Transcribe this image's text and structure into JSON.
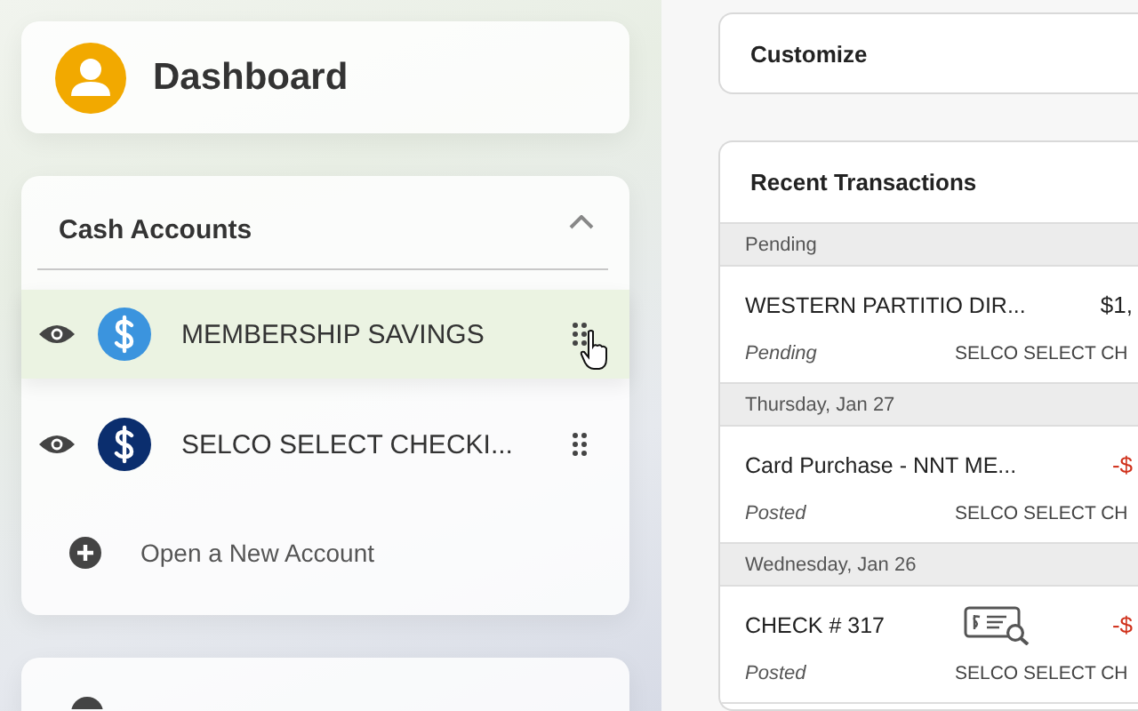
{
  "dashboard": {
    "title": "Dashboard"
  },
  "cash_accounts": {
    "title": "Cash Accounts",
    "expanded": true,
    "accounts": [
      {
        "name": "MEMBERSHIP SAVINGS",
        "color": "#3b94de",
        "highlighted": true
      },
      {
        "name": "SELCO SELECT CHECKI...",
        "color": "#0b2e6e",
        "highlighted": false
      }
    ],
    "open_account": "Open a New Account"
  },
  "customize": {
    "label": "Customize"
  },
  "recent_transactions": {
    "title": "Recent Transactions",
    "items": [
      {
        "kind": "group",
        "label": "Pending"
      },
      {
        "kind": "transaction",
        "description": "WESTERN PARTITIO DIR...",
        "amount": "$1,",
        "debit": false,
        "status": "Pending",
        "account": "SELCO SELECT CH",
        "check_image": false
      },
      {
        "kind": "group",
        "label": "Thursday, Jan 27"
      },
      {
        "kind": "transaction",
        "description": "Card Purchase - NNT ME...",
        "amount": "-$",
        "debit": true,
        "status": "Posted",
        "account": "SELCO SELECT CH",
        "check_image": false
      },
      {
        "kind": "group",
        "label": "Wednesday, Jan 26"
      },
      {
        "kind": "transaction",
        "description": "CHECK # 317",
        "amount": "-$",
        "debit": true,
        "status": "Posted",
        "account": "SELCO SELECT CH",
        "check_image": true
      }
    ]
  }
}
